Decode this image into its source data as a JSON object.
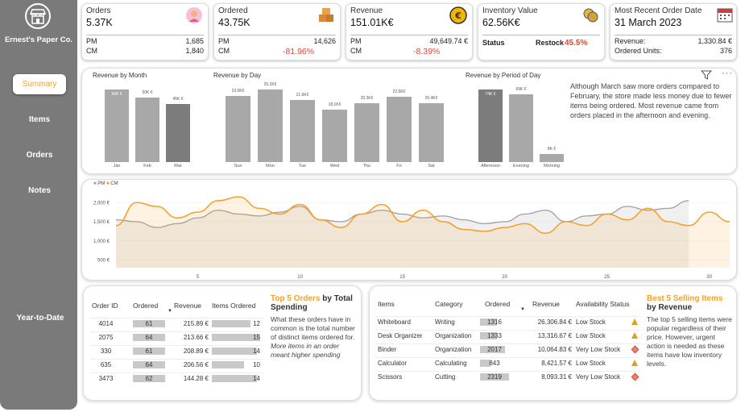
{
  "brand": {
    "name": "Ernest's Paper Co."
  },
  "nav": {
    "summary": "Summary",
    "items": "Items",
    "orders": "Orders",
    "notes": "Notes",
    "ytd": "Year-to-Date"
  },
  "kpis": {
    "orders": {
      "title": "Orders",
      "value": "5.37K",
      "pm_label": "PM",
      "pm": "1,685",
      "cm_label": "CM",
      "cm": "1,840"
    },
    "ordered": {
      "title": "Ordered",
      "value": "43.75K",
      "pm_label": "PM",
      "pm": "14,626",
      "cm_label": "CM",
      "change": "-81.96%"
    },
    "revenue": {
      "title": "Revenue",
      "value": "151.01K€",
      "pm_label": "PM",
      "pm": "49,649.74 €",
      "cm_label": "CM",
      "change": "-8.39%"
    },
    "inventory": {
      "title": "Inventory Value",
      "value": "62.56K€",
      "status_label": "Status",
      "status": "Restock",
      "pct": "45.5%"
    },
    "recent": {
      "title": "Most Recent Order Date",
      "value": "31 March 2023",
      "rev_label": "Revenue:",
      "rev": "1,330.84 €",
      "units_label": "Ordered Units:",
      "units": "376"
    }
  },
  "charts": {
    "month": {
      "title": "Revenue by Month",
      "labels": [
        "56K €",
        "50K €",
        "45K €"
      ],
      "categories": [
        "Jan",
        "Feb",
        "Mar"
      ]
    },
    "day": {
      "title": "Revenue by Day",
      "labels": [
        "23.0K€",
        "25.1K€",
        "21.6K€",
        "18.1K€",
        "20.3K€",
        "22.6K€",
        "20.4K€"
      ],
      "categories": [
        "Sun",
        "Mon",
        "Tue",
        "Wed",
        "Thu",
        "Fri",
        "Sat"
      ]
    },
    "period": {
      "title": "Revenue by Period of Day",
      "labels": [
        "74K €",
        "69K €",
        "8K €"
      ],
      "categories": [
        "Afternoon",
        "Evening",
        "Morning"
      ]
    }
  },
  "chart_data": [
    {
      "type": "bar",
      "title": "Revenue by Month",
      "categories": [
        "Jan",
        "Feb",
        "Mar"
      ],
      "values": [
        56,
        50,
        45
      ],
      "unit": "K€"
    },
    {
      "type": "bar",
      "title": "Revenue by Day",
      "categories": [
        "Sun",
        "Mon",
        "Tue",
        "Wed",
        "Thu",
        "Fri",
        "Sat"
      ],
      "values": [
        23.0,
        25.1,
        21.6,
        18.1,
        20.3,
        22.6,
        20.4
      ],
      "unit": "K€"
    },
    {
      "type": "bar",
      "title": "Revenue by Period of Day",
      "categories": [
        "Afternoon",
        "Evening",
        "Morning"
      ],
      "values": [
        74,
        69,
        8
      ],
      "unit": "K€"
    },
    {
      "type": "line",
      "x_ticks": [
        5,
        10,
        15,
        20,
        25,
        30
      ],
      "y_ticks": [
        "500 €",
        "1,000 €",
        "1,500 €",
        "2,000 €"
      ],
      "ylim": [
        300,
        2300
      ],
      "x": [
        1,
        2,
        3,
        4,
        5,
        6,
        7,
        8,
        9,
        10,
        11,
        12,
        13,
        14,
        15,
        16,
        17,
        18,
        19,
        20,
        21,
        22,
        23,
        24,
        25,
        26,
        27,
        28,
        29,
        30,
        31
      ],
      "series": [
        {
          "name": "PM",
          "color": "#a0a0a0",
          "values": [
            1550,
            1500,
            1350,
            1450,
            1600,
            1800,
            1700,
            1650,
            1750,
            1900,
            1550,
            1500,
            1700,
            1800,
            1700,
            1600,
            1650,
            1550,
            1450,
            1500,
            1700,
            1800,
            1500,
            1650,
            1700,
            1900,
            1800,
            1850,
            2050,
            null,
            null
          ]
        },
        {
          "name": "CM",
          "color": "#f5a02a",
          "values": [
            1400,
            2000,
            1900,
            1600,
            1750,
            2050,
            2150,
            1850,
            1700,
            1950,
            1550,
            1350,
            1700,
            1950,
            1500,
            1800,
            1500,
            1300,
            1250,
            1350,
            1450,
            1200,
            1500,
            1400,
            1700,
            1550,
            1850,
            1500,
            1400,
            1750,
            1500
          ]
        }
      ]
    }
  ],
  "line_chart": {
    "legend_pm": "PM",
    "legend_cm": "CM",
    "y_ticks": [
      "2,000 €",
      "1,500 €",
      "1,000 €",
      "500 €"
    ],
    "x_ticks": [
      "5",
      "10",
      "15",
      "20",
      "25",
      "30"
    ]
  },
  "notes_text": "Although March saw more orders compared to February, the store made less money due to fewer items being ordered. Most revenue came from orders placed in the afternoon and evening.",
  "orders_table": {
    "headers": [
      "Order ID",
      "Ordered",
      "Revenue",
      "Items Ordered"
    ],
    "rows": [
      {
        "id": "4014",
        "ordered": "61",
        "revenue": "215.89 €",
        "items": "12"
      },
      {
        "id": "2075",
        "ordered": "64",
        "revenue": "213.66 €",
        "items": "15"
      },
      {
        "id": "330",
        "ordered": "61",
        "revenue": "208.89 €",
        "items": "14"
      },
      {
        "id": "635",
        "ordered": "64",
        "revenue": "206.56 €",
        "items": "10"
      },
      {
        "id": "3473",
        "ordered": "62",
        "revenue": "144.28 €",
        "items": "14"
      }
    ],
    "heading_a": "Top 5 Orders",
    "heading_b": " by Total Spending",
    "text": "What these orders have in common is the total number of distinct items ordered for.",
    "text_em": "More items in an order meant higher spending"
  },
  "items_table": {
    "headers": [
      "Items",
      "Category",
      "Ordered",
      "Revenue",
      "Availability Status"
    ],
    "rows": [
      {
        "item": "Whiteboard",
        "cat": "Writing",
        "ordered": "1316",
        "revenue": "26,306.84 €",
        "status": "Low Stock",
        "level": "low",
        "fill": 0.57
      },
      {
        "item": "Desk Organizer",
        "cat": "Organization",
        "ordered": "1333",
        "revenue": "13,316.67 €",
        "status": "Low Stock",
        "level": "low",
        "fill": 0.57
      },
      {
        "item": "Binder",
        "cat": "Organization",
        "ordered": "2017",
        "revenue": "10,064.83 €",
        "status": "Very Low Stock",
        "level": "very",
        "fill": 0.87
      },
      {
        "item": "Calculator",
        "cat": "Calculating",
        "ordered": "843",
        "revenue": "8,421.57 €",
        "status": "Low Stock",
        "level": "low",
        "fill": 0.36
      },
      {
        "item": "Scissors",
        "cat": "Cutting",
        "ordered": "2319",
        "revenue": "8,093.31 €",
        "status": "Very Low Stock",
        "level": "very",
        "fill": 1.0
      }
    ],
    "heading_a": "Best 5 Selling Items",
    "heading_b": "by Revenue",
    "text": "The top 5 selling items were popular regardless of their price. However, urgent action is needed as these items have low inventory levels."
  },
  "colors": {
    "accent": "#f5a02a",
    "negative": "#e8452c",
    "bar": "#a8a8a8",
    "bar_dark": "#7c7c7c"
  }
}
